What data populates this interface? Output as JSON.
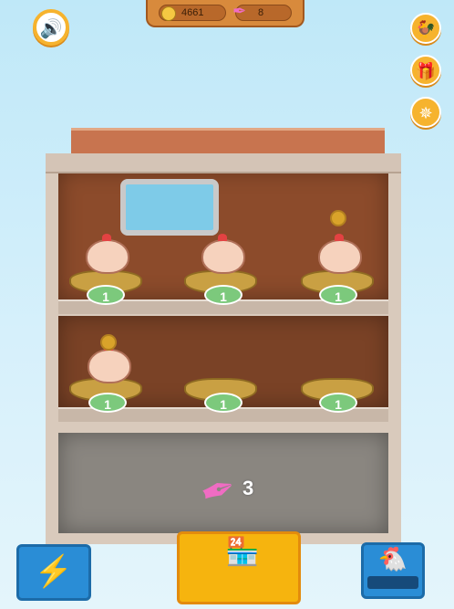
{
  "resources": {
    "coins": "4661",
    "feathers": "8"
  },
  "eggs": [
    "1",
    "1",
    "1",
    "1",
    "1",
    "1"
  ],
  "feather_count": "3",
  "icons": {
    "sound": "speaker-icon",
    "rooster": "rooster-icon",
    "gift": "gift-icon",
    "wheel": "wheel-icon",
    "boost": "lightning-icon",
    "shop": "shop-icon",
    "hens": "chicken-icon"
  },
  "colors": {
    "accent": "#f6b32e",
    "blue": "#2a8dd6",
    "egg": "#7cc97c",
    "feather": "#f06cc3"
  }
}
